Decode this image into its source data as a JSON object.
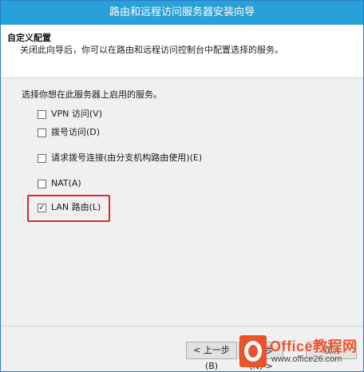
{
  "window": {
    "title": "路由和远程访问服务器安装向导"
  },
  "header": {
    "title": "自定义配置",
    "description": "关闭此向导后，你可以在路由和远程访问控制台中配置选择的服务。"
  },
  "content": {
    "prompt": "选择你想在此服务器上启用的服务。",
    "options": [
      {
        "label": "VPN 访问(V)",
        "checked": false
      },
      {
        "label": "拨号访问(D)",
        "checked": false
      },
      {
        "label": "请求拨号连接(由分支机构路由使用)(E)",
        "checked": false
      },
      {
        "label": "NAT(A)",
        "checked": false
      },
      {
        "label": "LAN 路由(L)",
        "checked": true
      }
    ]
  },
  "footer": {
    "back_label": "< 上一步(B)",
    "next_label": "下一步(N) >",
    "cancel_label": "取消"
  },
  "watermark": {
    "brand": "Office教程网",
    "url": "www.office26.com"
  },
  "colors": {
    "titlebar": "#28a0d8",
    "highlight": "#e0282e",
    "watermark": "#e9542a"
  }
}
